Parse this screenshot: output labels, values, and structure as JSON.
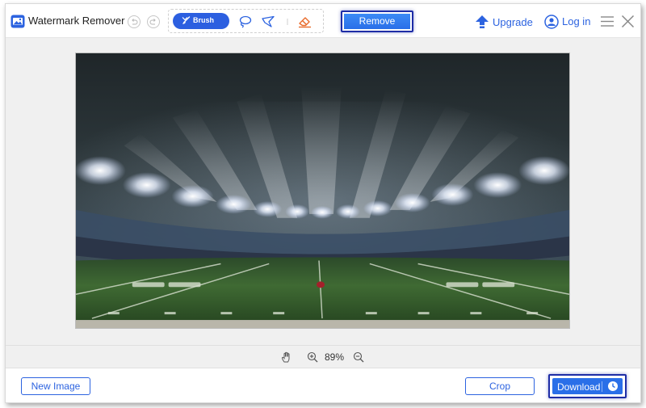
{
  "app": {
    "title": "Watermark Remover"
  },
  "toolbar": {
    "brush_label": "Brush",
    "remove_label": "Remove",
    "upgrade_label": "Upgrade",
    "login_label": "Log in"
  },
  "canvas": {
    "zoom_level": "89%"
  },
  "footer": {
    "new_image_label": "New Image",
    "crop_label": "Crop",
    "download_label": "Download"
  },
  "colors": {
    "accent": "#2c63e0",
    "highlight_border": "#1e2da6",
    "eraser": "#e96b2b"
  }
}
